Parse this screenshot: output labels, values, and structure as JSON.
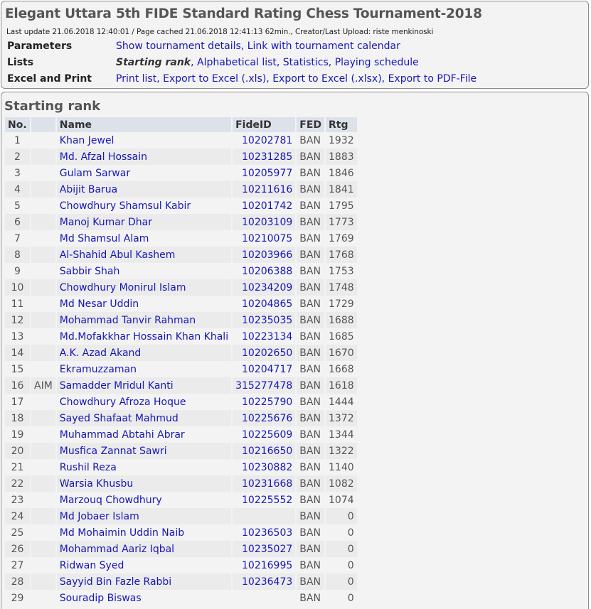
{
  "header": {
    "title": "Elegant Uttara 5th FIDE Standard Rating Chess Tournament-2018",
    "update": "Last update 21.06.2018 12:40:01 / Page cached 21.06.2018 12:41:13 62min., Creator/Last Upload: riste menkinoski",
    "parameters": {
      "label": "Parameters",
      "links": [
        "Show tournament details",
        "Link with tournament calendar"
      ]
    },
    "lists": {
      "label": "Lists",
      "current": "Starting rank",
      "links": [
        "Alphabetical list",
        "Statistics",
        "Playing schedule"
      ]
    },
    "excel": {
      "label": "Excel and Print",
      "links": [
        "Print list",
        "Export to Excel (.xls)",
        "Export to Excel (.xlsx)",
        "Export to PDF-File"
      ]
    }
  },
  "starting_rank": {
    "section_title": "Starting rank",
    "columns": [
      "No.",
      "",
      "Name",
      "FideID",
      "FED",
      "Rtg"
    ],
    "rows": [
      {
        "no": "1",
        "title": "",
        "name": "Khan Jewel",
        "fide": "10202781",
        "fed": "BAN",
        "rtg": "1932"
      },
      {
        "no": "2",
        "title": "",
        "name": "Md. Afzal Hossain",
        "fide": "10231285",
        "fed": "BAN",
        "rtg": "1883"
      },
      {
        "no": "3",
        "title": "",
        "name": "Gulam Sarwar",
        "fide": "10205977",
        "fed": "BAN",
        "rtg": "1846"
      },
      {
        "no": "4",
        "title": "",
        "name": "Abijit Barua",
        "fide": "10211616",
        "fed": "BAN",
        "rtg": "1841"
      },
      {
        "no": "5",
        "title": "",
        "name": "Chowdhury Shamsul Kabir",
        "fide": "10201742",
        "fed": "BAN",
        "rtg": "1795"
      },
      {
        "no": "6",
        "title": "",
        "name": "Manoj Kumar Dhar",
        "fide": "10203109",
        "fed": "BAN",
        "rtg": "1773"
      },
      {
        "no": "7",
        "title": "",
        "name": "Md Shamsul Alam",
        "fide": "10210075",
        "fed": "BAN",
        "rtg": "1769"
      },
      {
        "no": "8",
        "title": "",
        "name": "Al-Shahid Abul Kashem",
        "fide": "10203966",
        "fed": "BAN",
        "rtg": "1768"
      },
      {
        "no": "9",
        "title": "",
        "name": "Sabbir Shah",
        "fide": "10206388",
        "fed": "BAN",
        "rtg": "1753"
      },
      {
        "no": "10",
        "title": "",
        "name": "Chowdhury Monirul Islam",
        "fide": "10234209",
        "fed": "BAN",
        "rtg": "1748"
      },
      {
        "no": "11",
        "title": "",
        "name": "Md Nesar Uddin",
        "fide": "10204865",
        "fed": "BAN",
        "rtg": "1729"
      },
      {
        "no": "12",
        "title": "",
        "name": "Mohammad Tanvir Rahman",
        "fide": "10235035",
        "fed": "BAN",
        "rtg": "1688"
      },
      {
        "no": "13",
        "title": "",
        "name": "Md.Mofakkhar Hossain Khan Khali",
        "fide": "10223134",
        "fed": "BAN",
        "rtg": "1685"
      },
      {
        "no": "14",
        "title": "",
        "name": "A.K. Azad Akand",
        "fide": "10202650",
        "fed": "BAN",
        "rtg": "1670"
      },
      {
        "no": "15",
        "title": "",
        "name": "Ekramuzzaman",
        "fide": "10204717",
        "fed": "BAN",
        "rtg": "1668"
      },
      {
        "no": "16",
        "title": "AIM",
        "name": "Samadder Mridul Kanti",
        "fide": "315277478",
        "fed": "BAN",
        "rtg": "1618"
      },
      {
        "no": "17",
        "title": "",
        "name": "Chowdhury Afroza Hoque",
        "fide": "10225790",
        "fed": "BAN",
        "rtg": "1444"
      },
      {
        "no": "18",
        "title": "",
        "name": "Sayed Shafaat Mahmud",
        "fide": "10225676",
        "fed": "BAN",
        "rtg": "1372"
      },
      {
        "no": "19",
        "title": "",
        "name": "Muhammad Abtahi Abrar",
        "fide": "10225609",
        "fed": "BAN",
        "rtg": "1344"
      },
      {
        "no": "20",
        "title": "",
        "name": "Musfica Zannat Sawri",
        "fide": "10216650",
        "fed": "BAN",
        "rtg": "1322"
      },
      {
        "no": "21",
        "title": "",
        "name": "Rushil Reza",
        "fide": "10230882",
        "fed": "BAN",
        "rtg": "1140"
      },
      {
        "no": "22",
        "title": "",
        "name": "Warsia Khusbu",
        "fide": "10231668",
        "fed": "BAN",
        "rtg": "1082"
      },
      {
        "no": "23",
        "title": "",
        "name": "Marzouq Chowdhury",
        "fide": "10225552",
        "fed": "BAN",
        "rtg": "1074"
      },
      {
        "no": "24",
        "title": "",
        "name": "Md Jobaer Islam",
        "fide": "",
        "fed": "BAN",
        "rtg": "0"
      },
      {
        "no": "25",
        "title": "",
        "name": "Md Mohaimin Uddin Naib",
        "fide": "10236503",
        "fed": "BAN",
        "rtg": "0"
      },
      {
        "no": "26",
        "title": "",
        "name": "Mohammad Aariz Iqbal",
        "fide": "10235027",
        "fed": "BAN",
        "rtg": "0"
      },
      {
        "no": "27",
        "title": "",
        "name": "Ridwan Syed",
        "fide": "10216995",
        "fed": "BAN",
        "rtg": "0"
      },
      {
        "no": "28",
        "title": "",
        "name": "Sayyid Bin Fazle Rabbi",
        "fide": "10236473",
        "fed": "BAN",
        "rtg": "0"
      },
      {
        "no": "29",
        "title": "",
        "name": "Souradip Biswas",
        "fide": "",
        "fed": "BAN",
        "rtg": "0"
      }
    ]
  },
  "colors": {
    "link": "#1616b8",
    "header_bg": "#dde2ea",
    "row_odd": "#f3f3f3",
    "row_even": "#ebebeb",
    "panel_border": "#8c8c8c"
  }
}
